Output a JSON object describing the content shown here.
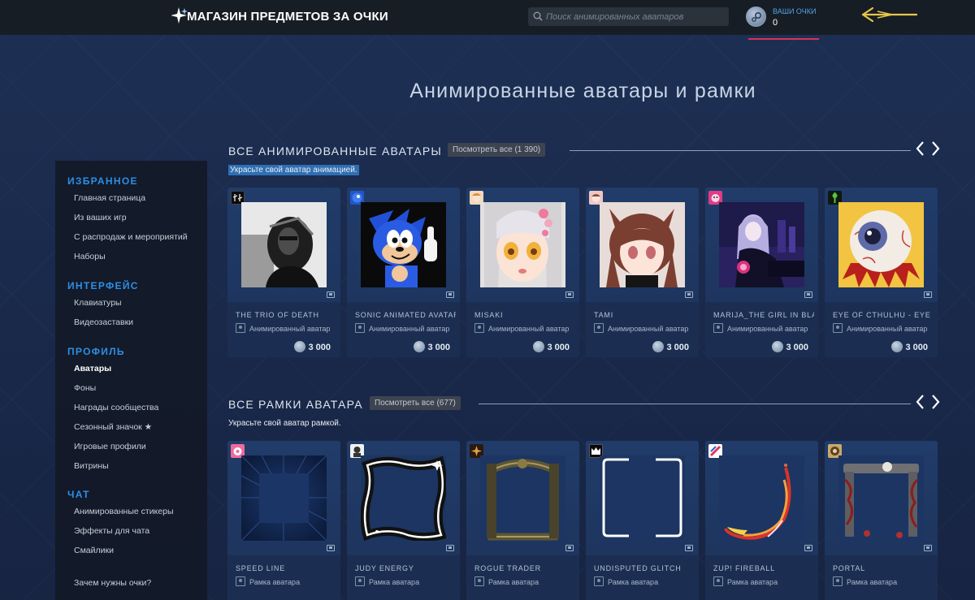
{
  "header": {
    "store_title": "МАГАЗИН ПРЕДМЕТОВ ЗА ОЧКИ",
    "search_placeholder": "Поиск анимированных аватаров",
    "points_label": "ВАШИ ОЧКИ",
    "points_value": "0"
  },
  "hero": {
    "title": "Анимированные аватары и рамки"
  },
  "sidebar": {
    "sections": [
      {
        "heading": "ИЗБРАННОЕ",
        "items": [
          "Главная страница",
          "Из ваших игр",
          "С распродаж и мероприятий",
          "Наборы"
        ]
      },
      {
        "heading": "ИНТЕРФЕЙС",
        "items": [
          "Клавиатуры",
          "Видеозаставки"
        ]
      },
      {
        "heading": "ПРОФИЛЬ",
        "items": [
          "Аватары",
          "Фоны",
          "Награды сообщества",
          "Сезонный значок ★",
          "Игровые профили",
          "Витрины"
        ]
      },
      {
        "heading": "ЧАТ",
        "items": [
          "Анимированные стикеры",
          "Эффекты для чата",
          "Смайлики"
        ]
      }
    ],
    "active_item": "Аватары",
    "footer_link": "Зачем нужны очки?"
  },
  "avatars_section": {
    "title": "ВСЕ АНИМИРОВАННЫЕ АВАТАРЫ",
    "view_all": "Посмотреть все (1 390)",
    "subtitle": "Украсьте свой аватар анимацией.",
    "item_type": "Анимированный аватар",
    "items": [
      {
        "name": "THE TRIO OF DEATH",
        "price": "3 000"
      },
      {
        "name": "SONIC ANIMATED AVATAR",
        "price": "3 000"
      },
      {
        "name": "MISAKI",
        "price": "3 000"
      },
      {
        "name": "TAMI",
        "price": "3 000"
      },
      {
        "name": "MARIJA_THE GIRL IN BLACK",
        "price": "3 000"
      },
      {
        "name": "EYE OF CTHULHU - EYE",
        "price": "3 000"
      }
    ]
  },
  "frames_section": {
    "title": "ВСЕ РАМКИ АВАТАРА",
    "view_all": "Посмотреть все (677)",
    "subtitle": "Украсьте свой аватар рамкой.",
    "item_type": "Рамка аватара",
    "items": [
      {
        "name": "SPEED LINE"
      },
      {
        "name": "JUDY ENERGY"
      },
      {
        "name": "ROGUE TRADER"
      },
      {
        "name": "UNDISPUTED GLITCH"
      },
      {
        "name": "ZUP! FIREBALL"
      },
      {
        "name": "PORTAL"
      }
    ]
  },
  "colors": {
    "topbar": "#171d25",
    "accent_blue": "#2d8fe6",
    "points_underline": "#d6325a",
    "card_bg": "#213c6a"
  }
}
